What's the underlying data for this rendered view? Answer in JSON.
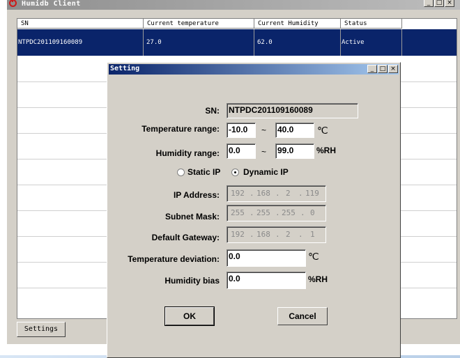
{
  "main_window": {
    "title": "Humidb Client",
    "controls": {
      "minimize": "_",
      "maximize": "□",
      "close": "×"
    },
    "table": {
      "columns": [
        "SN",
        "Current temperature",
        "Current Humidity",
        "Status"
      ],
      "rows": [
        {
          "sn": "NTPDC201109160089",
          "temperature": "27.0",
          "humidity": "62.0",
          "status": "Active",
          "selected": true
        }
      ]
    },
    "settings_button": "Settings"
  },
  "dialog": {
    "title": "Setting",
    "controls": {
      "minimize": "_",
      "maximize": "□",
      "close": "×"
    },
    "sn": {
      "label": "SN:",
      "value": "NTPDC201109160089"
    },
    "temperature_range": {
      "label": "Temperature range:",
      "min": "-10.0",
      "sep": "~",
      "max": "40.0",
      "unit": "℃"
    },
    "humidity_range": {
      "label": "Humidity range:",
      "min": "0.0",
      "sep": "~",
      "max": "99.0",
      "unit": "%RH"
    },
    "ip_mode": {
      "static_label": "Static IP",
      "dynamic_label": "Dynamic IP",
      "selected": "dynamic"
    },
    "ip_address": {
      "label": "IP Address:",
      "octets": [
        "192",
        "168",
        "2",
        "119"
      ]
    },
    "subnet_mask": {
      "label": "Subnet Mask:",
      "octets": [
        "255",
        "255",
        "255",
        "0"
      ]
    },
    "default_gateway": {
      "label": "Default Gateway:",
      "octets": [
        "192",
        "168",
        "2",
        "1"
      ]
    },
    "temperature_deviation": {
      "label": "Temperature deviation:",
      "value": "0.0",
      "unit": "℃"
    },
    "humidity_bias": {
      "label": "Humidity bias",
      "value": "0.0",
      "unit": "%RH"
    },
    "ok_button": "OK",
    "cancel_button": "Cancel"
  }
}
